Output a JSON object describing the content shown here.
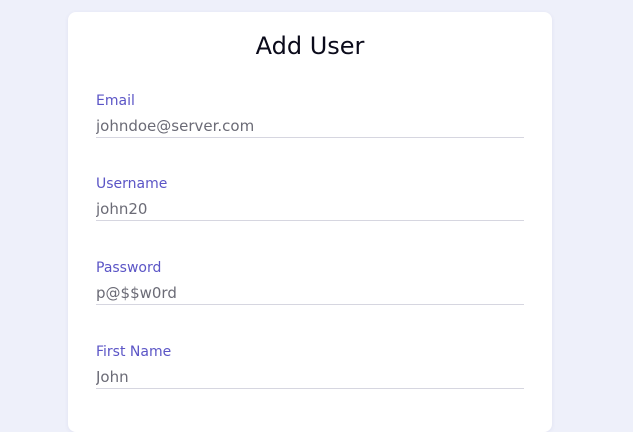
{
  "form": {
    "title": "Add User",
    "fields": [
      {
        "label": "Email",
        "placeholder": "johndoe@server.com"
      },
      {
        "label": "Username",
        "placeholder": "john20"
      },
      {
        "label": "Password",
        "placeholder": "p@$$w0rd"
      },
      {
        "label": "First Name",
        "placeholder": "John"
      }
    ]
  },
  "colors": {
    "background": "#eef0fa",
    "card": "#ffffff",
    "label": "#5b55c6",
    "title": "#0a0a1a",
    "input_text": "#6b6b76",
    "underline": "#d6d6e0"
  }
}
